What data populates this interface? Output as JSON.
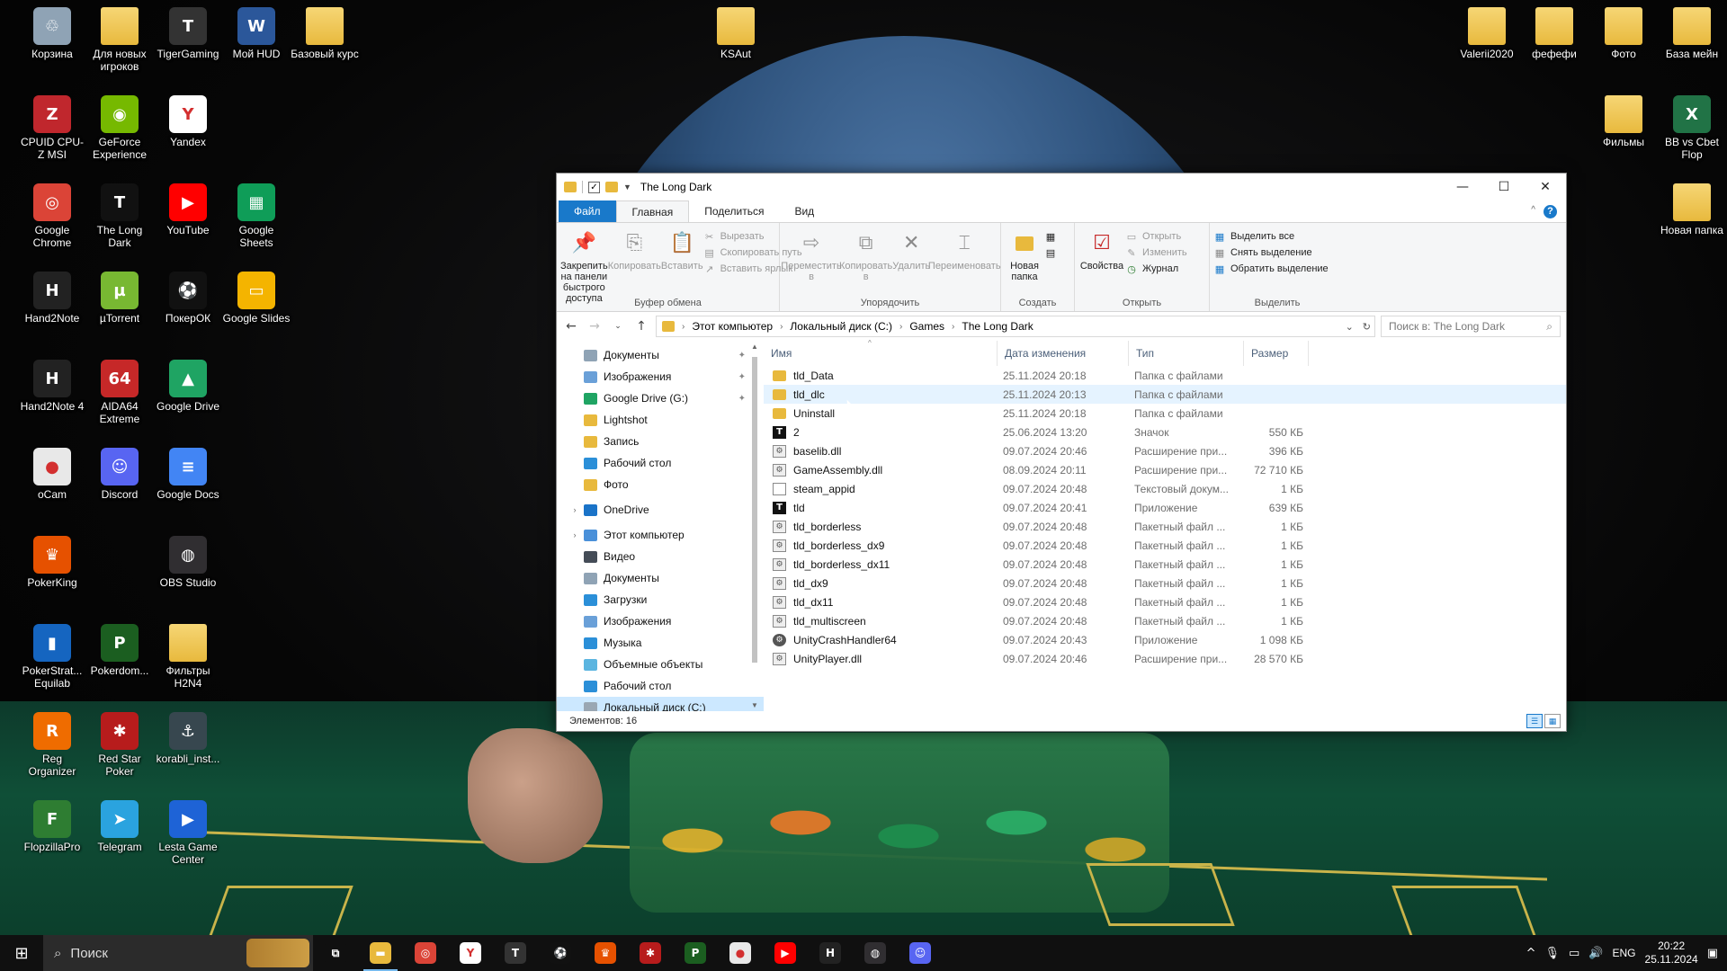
{
  "desktop_icons": [
    {
      "label": "Корзина",
      "icon": "recycle-bin-icon",
      "color": "#8fa3b5",
      "glyph": "♲"
    },
    {
      "label": "Для новых игроков",
      "icon": "folder-icon",
      "color": "#e8b93d",
      "glyph": ""
    },
    {
      "label": "TigerGaming",
      "icon": "tigergaming-icon",
      "color": "#333333",
      "glyph": "T"
    },
    {
      "label": "Мой HUD",
      "icon": "word-icon",
      "color": "#2b579a",
      "glyph": "W"
    },
    {
      "label": "Базовый курс",
      "icon": "folder-icon",
      "color": "#e8b93d",
      "glyph": ""
    },
    {
      "label": "CPUID CPU-Z MSI",
      "icon": "cpuz-icon",
      "color": "#c0272d",
      "glyph": "Z"
    },
    {
      "label": "GeForce Experience",
      "icon": "nvidia-icon",
      "color": "#76b900",
      "glyph": "◉"
    },
    {
      "label": "Yandex",
      "icon": "yandex-browser-icon",
      "color": "#ffffff",
      "glyph": "Y"
    },
    {
      "label": "Google Chrome",
      "icon": "chrome-icon",
      "color": "#db4437",
      "glyph": "◎"
    },
    {
      "label": "The Long Dark",
      "icon": "the-long-dark-icon",
      "color": "#111111",
      "glyph": "T"
    },
    {
      "label": "YouTube",
      "icon": "youtube-icon",
      "color": "#ff0000",
      "glyph": "▶"
    },
    {
      "label": "Google Sheets",
      "icon": "google-sheets-icon",
      "color": "#0f9d58",
      "glyph": "▦"
    },
    {
      "label": "Hand2Note",
      "icon": "hand2note-icon",
      "color": "#222222",
      "glyph": "H"
    },
    {
      "label": "µTorrent",
      "icon": "utorrent-icon",
      "color": "#78b832",
      "glyph": "µ"
    },
    {
      "label": "ПокерОК",
      "icon": "pokerok-icon",
      "color": "#111111",
      "glyph": "⚽"
    },
    {
      "label": "Google Slides",
      "icon": "google-slides-icon",
      "color": "#f4b400",
      "glyph": "▭"
    },
    {
      "label": "Hand2Note 4",
      "icon": "hand2note-icon",
      "color": "#222222",
      "glyph": "H"
    },
    {
      "label": "AIDA64 Extreme",
      "icon": "aida64-icon",
      "color": "#c62828",
      "glyph": "64"
    },
    {
      "label": "Google Drive",
      "icon": "google-drive-icon",
      "color": "#1fa463",
      "glyph": "▲"
    },
    {
      "label": "oCam",
      "icon": "ocam-icon",
      "color": "#e8e8e8",
      "glyph": "●"
    },
    {
      "label": "Discord",
      "icon": "discord-icon",
      "color": "#5865f2",
      "glyph": "☺"
    },
    {
      "label": "Google Docs",
      "icon": "google-docs-icon",
      "color": "#4285f4",
      "glyph": "≡"
    },
    {
      "label": "PokerKing",
      "icon": "pokerking-icon",
      "color": "#e65100",
      "glyph": "♛"
    },
    {
      "label": "OBS Studio",
      "icon": "obs-icon",
      "color": "#302e31",
      "glyph": "◍"
    },
    {
      "label": "PokerStrat... Equilab",
      "icon": "equilab-icon",
      "color": "#1565c0",
      "glyph": "▮"
    },
    {
      "label": "Pokerdom...",
      "icon": "pokerdom-icon",
      "color": "#1b5e20",
      "glyph": "P"
    },
    {
      "label": "Фильтры H2N4",
      "icon": "folder-icon",
      "color": "#e8b93d",
      "glyph": ""
    },
    {
      "label": "Reg Organizer",
      "icon": "reg-organizer-icon",
      "color": "#ef6c00",
      "glyph": "R"
    },
    {
      "label": "Red Star Poker",
      "icon": "red-star-poker-icon",
      "color": "#b71c1c",
      "glyph": "✱"
    },
    {
      "label": "korabli_inst...",
      "icon": "korabli-icon",
      "color": "#37474f",
      "glyph": "⚓"
    },
    {
      "label": "FlopzillaPro",
      "icon": "flopzilla-icon",
      "color": "#2e7d32",
      "glyph": "F"
    },
    {
      "label": "Telegram",
      "icon": "telegram-icon",
      "color": "#2aa3df",
      "glyph": "➤"
    },
    {
      "label": "Lesta Game Center",
      "icon": "lesta-icon",
      "color": "#1e63d6",
      "glyph": "▶"
    },
    {
      "label": "KSAut",
      "icon": "folder-icon",
      "color": "#e8b93d",
      "glyph": ""
    },
    {
      "label": "Valerii2020",
      "icon": "folder-icon",
      "color": "#e8b93d",
      "glyph": ""
    },
    {
      "label": "фефефи",
      "icon": "folder-icon",
      "color": "#e8b93d",
      "glyph": ""
    },
    {
      "label": "Фото",
      "icon": "folder-icon",
      "color": "#e8b93d",
      "glyph": ""
    },
    {
      "label": "База мейн",
      "icon": "folder-icon",
      "color": "#e8b93d",
      "glyph": ""
    },
    {
      "label": "Фильмы",
      "icon": "folder-icon",
      "color": "#e8b93d",
      "glyph": ""
    },
    {
      "label": "BB vs Cbet Flop",
      "icon": "excel-icon",
      "color": "#217346",
      "glyph": "X"
    },
    {
      "label": "Новая папка",
      "icon": "folder-icon",
      "color": "#e8b93d",
      "glyph": ""
    }
  ],
  "window": {
    "title": "The Long Dark",
    "controls": {
      "minimize": "—",
      "maximize": "☐",
      "close": "✕"
    }
  },
  "ribbon_tabs": [
    "Файл",
    "Главная",
    "Поделиться",
    "Вид"
  ],
  "ribbon": {
    "clipboard": {
      "group": "Буфер обмена",
      "pin": "Закрепить на панели быстрого доступа",
      "copy": "Копировать",
      "paste": "Вставить",
      "cut": "Вырезать",
      "copy_path": "Скопировать путь",
      "paste_shortcut": "Вставить ярлык"
    },
    "organize": {
      "group": "Упорядочить",
      "move": "Переместить в",
      "copy_to": "Копировать в",
      "delete": "Удалить",
      "rename": "Переименовать"
    },
    "new": {
      "group": "Создать",
      "new_folder": "Новая папка"
    },
    "open": {
      "group": "Открыть",
      "properties": "Свойства",
      "open": "Открыть",
      "edit": "Изменить",
      "history": "Журнал"
    },
    "select": {
      "group": "Выделить",
      "select_all": "Выделить все",
      "select_none": "Снять выделение",
      "invert": "Обратить выделение"
    }
  },
  "address": {
    "crumbs": [
      "Этот компьютер",
      "Локальный диск (C:)",
      "Games",
      "The Long Dark"
    ],
    "search_placeholder": "Поиск в: The Long Dark"
  },
  "nav": [
    {
      "label": "Документы",
      "icon": "documents-icon",
      "color": "#8fa3b5",
      "pinned": true
    },
    {
      "label": "Изображения",
      "icon": "pictures-icon",
      "color": "#6aa0d8",
      "pinned": true
    },
    {
      "label": "Google Drive (G:)",
      "icon": "google-drive-icon",
      "color": "#1fa463",
      "pinned": true
    },
    {
      "label": "Lightshot",
      "icon": "folder-icon",
      "color": "#e8b93d",
      "pinned": false
    },
    {
      "label": "Запись",
      "icon": "folder-icon",
      "color": "#e8b93d",
      "pinned": false
    },
    {
      "label": "Рабочий стол",
      "icon": "desktop-icon",
      "color": "#2b8fd8",
      "pinned": false
    },
    {
      "label": "Фото",
      "icon": "folder-icon",
      "color": "#e8b93d",
      "pinned": false
    },
    {
      "label": "OneDrive",
      "icon": "onedrive-icon",
      "color": "#1a73c8",
      "pinned": false,
      "top": true
    },
    {
      "label": "Этот компьютер",
      "icon": "computer-icon",
      "color": "#4a90d9",
      "pinned": false,
      "top": true
    },
    {
      "label": "Видео",
      "icon": "video-icon",
      "color": "#444c57",
      "pinned": false
    },
    {
      "label": "Документы",
      "icon": "documents-icon",
      "color": "#8fa3b5",
      "pinned": false
    },
    {
      "label": "Загрузки",
      "icon": "downloads-icon",
      "color": "#2b8fd8",
      "pinned": false
    },
    {
      "label": "Изображения",
      "icon": "pictures-icon",
      "color": "#6aa0d8",
      "pinned": false
    },
    {
      "label": "Музыка",
      "icon": "music-icon",
      "color": "#2b8fd8",
      "pinned": false
    },
    {
      "label": "Объемные объекты",
      "icon": "3d-objects-icon",
      "color": "#5bb5e0",
      "pinned": false
    },
    {
      "label": "Рабочий стол",
      "icon": "desktop-icon",
      "color": "#2b8fd8",
      "pinned": false
    },
    {
      "label": "Локальный диск (C:)",
      "icon": "drive-icon",
      "color": "#9aa7b3",
      "pinned": false,
      "selected": true
    }
  ],
  "columns": [
    "Имя",
    "Дата изменения",
    "Тип",
    "Размер"
  ],
  "files": [
    {
      "name": "tld_Data",
      "date": "25.11.2024 20:18",
      "type": "Папка с файлами",
      "size": "",
      "kind": "folder"
    },
    {
      "name": "tld_dlc",
      "date": "25.11.2024 20:13",
      "type": "Папка с файлами",
      "size": "",
      "kind": "folder",
      "hover": true
    },
    {
      "name": "Uninstall",
      "date": "25.11.2024 20:18",
      "type": "Папка с файлами",
      "size": "",
      "kind": "folder"
    },
    {
      "name": "2",
      "date": "25.06.2024 13:20",
      "type": "Значок",
      "size": "550 КБ",
      "kind": "app"
    },
    {
      "name": "baselib.dll",
      "date": "09.07.2024 20:46",
      "type": "Расширение при...",
      "size": "396 КБ",
      "kind": "gear"
    },
    {
      "name": "GameAssembly.dll",
      "date": "08.09.2024 20:11",
      "type": "Расширение при...",
      "size": "72 710 КБ",
      "kind": "gear"
    },
    {
      "name": "steam_appid",
      "date": "09.07.2024 20:48",
      "type": "Текстовый докум...",
      "size": "1 КБ",
      "kind": "doc"
    },
    {
      "name": "tld",
      "date": "09.07.2024 20:41",
      "type": "Приложение",
      "size": "639 КБ",
      "kind": "app"
    },
    {
      "name": "tld_borderless",
      "date": "09.07.2024 20:48",
      "type": "Пакетный файл ...",
      "size": "1 КБ",
      "kind": "gear"
    },
    {
      "name": "tld_borderless_dx9",
      "date": "09.07.2024 20:48",
      "type": "Пакетный файл ...",
      "size": "1 КБ",
      "kind": "gear"
    },
    {
      "name": "tld_borderless_dx11",
      "date": "09.07.2024 20:48",
      "type": "Пакетный файл ...",
      "size": "1 КБ",
      "kind": "gear"
    },
    {
      "name": "tld_dx9",
      "date": "09.07.2024 20:48",
      "type": "Пакетный файл ...",
      "size": "1 КБ",
      "kind": "gear"
    },
    {
      "name": "tld_dx11",
      "date": "09.07.2024 20:48",
      "type": "Пакетный файл ...",
      "size": "1 КБ",
      "kind": "gear"
    },
    {
      "name": "tld_multiscreen",
      "date": "09.07.2024 20:48",
      "type": "Пакетный файл ...",
      "size": "1 КБ",
      "kind": "gear"
    },
    {
      "name": "UnityCrashHandler64",
      "date": "09.07.2024 20:43",
      "type": "Приложение",
      "size": "1 098 КБ",
      "kind": "crash"
    },
    {
      "name": "UnityPlayer.dll",
      "date": "09.07.2024 20:46",
      "type": "Расширение при...",
      "size": "28 570 КБ",
      "kind": "gear"
    }
  ],
  "status": {
    "items": "Элементов: 16"
  },
  "taskbar": {
    "search_placeholder": "Поиск",
    "apps": [
      {
        "name": "task-view-icon",
        "color": "#101010",
        "glyph": "⧉"
      },
      {
        "name": "file-explorer-icon",
        "color": "#e8b93d",
        "glyph": "▬",
        "active": true
      },
      {
        "name": "chrome-icon",
        "color": "#db4437",
        "glyph": "◎"
      },
      {
        "name": "yandex-browser-icon",
        "color": "#ffffff",
        "glyph": "Y"
      },
      {
        "name": "tigergaming-icon",
        "color": "#333333",
        "glyph": "T"
      },
      {
        "name": "pokerok-icon",
        "color": "#111111",
        "glyph": "⚽"
      },
      {
        "name": "pokerking-icon",
        "color": "#e65100",
        "glyph": "♛"
      },
      {
        "name": "red-star-poker-icon",
        "color": "#b71c1c",
        "glyph": "✱"
      },
      {
        "name": "pokerdom-icon",
        "color": "#1b5e20",
        "glyph": "P"
      },
      {
        "name": "ocam-icon",
        "color": "#e8e8e8",
        "glyph": "●"
      },
      {
        "name": "youtube-icon",
        "color": "#ff0000",
        "glyph": "▶"
      },
      {
        "name": "hand2note-icon",
        "color": "#222222",
        "glyph": "H"
      },
      {
        "name": "obs-icon",
        "color": "#302e31",
        "glyph": "◍"
      },
      {
        "name": "discord-icon",
        "color": "#5865f2",
        "glyph": "☺"
      }
    ],
    "lang": "ENG",
    "time": "20:22",
    "date": "25.11.2024"
  }
}
